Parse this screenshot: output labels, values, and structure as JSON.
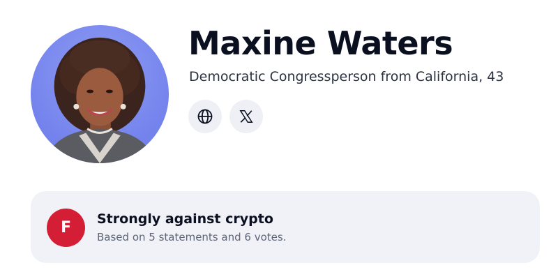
{
  "profile": {
    "name": "Maxine Waters",
    "subtitle": "Democratic Congressperson from California, 43",
    "avatar_alt": "Maxine Waters",
    "links": [
      {
        "icon": "globe-icon",
        "label": "Website"
      },
      {
        "icon": "x-logo-icon",
        "label": "X"
      }
    ]
  },
  "stance": {
    "grade": "F",
    "title": "Strongly against crypto",
    "detail": "Based on 5 statements and 6 votes.",
    "grade_color": "#d31e35"
  },
  "colors": {
    "card_background": "#f0f2f7",
    "icon_button_background": "#eef0f5",
    "avatar_background": "#7786ee"
  }
}
